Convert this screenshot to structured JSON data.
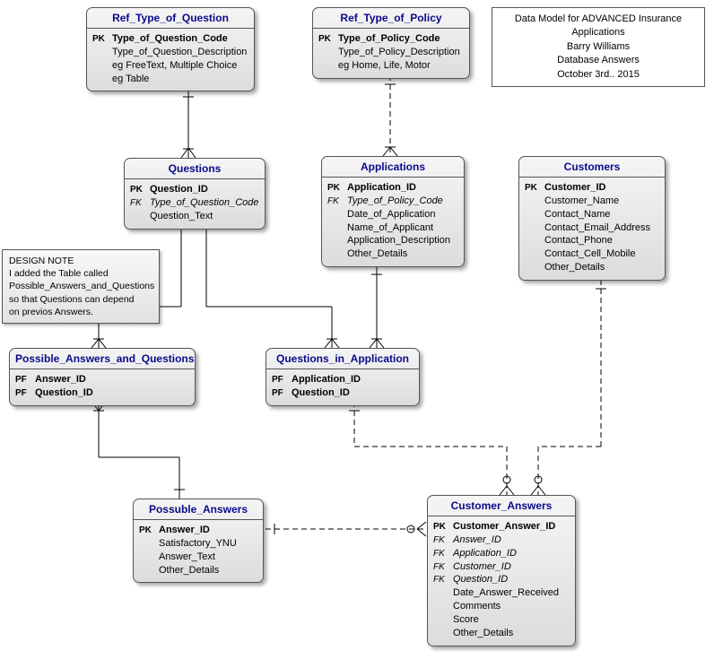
{
  "header": {
    "line1": "Data Model for ADVANCED Insurance Applications",
    "line2": "Barry Williams",
    "line3": "Database Answers",
    "line4": "October 3rd.. 2015"
  },
  "designNote": {
    "line1": "DESIGN NOTE",
    "line2": "I added the Table called",
    "line3": "Possible_Answers_and_Questions",
    "line4": "so that Questions can depend",
    "line5": "on previos Answers."
  },
  "entities": {
    "refTypeQuestion": {
      "title": "Ref_Type_of_Question",
      "attrs": [
        {
          "key": "PK",
          "name": "Type_of_Question_Code",
          "cls": "pk"
        },
        {
          "key": "",
          "name": "Type_of_Question_Description",
          "cls": ""
        },
        {
          "key": "",
          "name": "eg FreeText, Multiple Choice",
          "cls": ""
        },
        {
          "key": "",
          "name": "eg Table",
          "cls": ""
        }
      ]
    },
    "refTypePolicy": {
      "title": "Ref_Type_of_Policy",
      "attrs": [
        {
          "key": "PK",
          "name": "Type_of_Policy_Code",
          "cls": "pk"
        },
        {
          "key": "",
          "name": "Type_of_Policy_Description",
          "cls": ""
        },
        {
          "key": "",
          "name": "eg Home, Life, Motor",
          "cls": ""
        }
      ]
    },
    "questions": {
      "title": "Questions",
      "attrs": [
        {
          "key": "PK",
          "name": "Question_ID",
          "cls": "pk"
        },
        {
          "key": "FK",
          "name": "Type_of_Question_Code",
          "cls": "fk"
        },
        {
          "key": "",
          "name": "Question_Text",
          "cls": ""
        }
      ]
    },
    "applications": {
      "title": "Applications",
      "attrs": [
        {
          "key": "PK",
          "name": "Application_ID",
          "cls": "pk"
        },
        {
          "key": "FK",
          "name": "Type_of_Policy_Code",
          "cls": "fk"
        },
        {
          "key": "",
          "name": "Date_of_Application",
          "cls": ""
        },
        {
          "key": "",
          "name": "Name_of_Applicant",
          "cls": ""
        },
        {
          "key": "",
          "name": "Application_Description",
          "cls": ""
        },
        {
          "key": "",
          "name": "Other_Details",
          "cls": ""
        }
      ]
    },
    "customers": {
      "title": "Customers",
      "attrs": [
        {
          "key": "PK",
          "name": "Customer_ID",
          "cls": "pk"
        },
        {
          "key": "",
          "name": "Customer_Name",
          "cls": ""
        },
        {
          "key": "",
          "name": "Contact_Name",
          "cls": ""
        },
        {
          "key": "",
          "name": "Contact_Email_Address",
          "cls": ""
        },
        {
          "key": "",
          "name": "Contact_Phone",
          "cls": ""
        },
        {
          "key": "",
          "name": "Contact_Cell_Mobile",
          "cls": ""
        },
        {
          "key": "",
          "name": "Other_Details",
          "cls": ""
        }
      ]
    },
    "paq": {
      "title": "Possible_Answers_and_Questions",
      "attrs": [
        {
          "key": "PF",
          "name": "Answer_ID",
          "cls": "pk"
        },
        {
          "key": "PF",
          "name": "Question_ID",
          "cls": "pk"
        }
      ]
    },
    "qia": {
      "title": "Questions_in_Application",
      "attrs": [
        {
          "key": "PF",
          "name": "Application_ID",
          "cls": "pk"
        },
        {
          "key": "PF",
          "name": "Question_ID",
          "cls": "pk"
        }
      ]
    },
    "possibleAnswers": {
      "title": "Possuble_Answers",
      "attrs": [
        {
          "key": "PK",
          "name": "Answer_ID",
          "cls": "pk"
        },
        {
          "key": "",
          "name": "Satisfactory_YNU",
          "cls": ""
        },
        {
          "key": "",
          "name": "Answer_Text",
          "cls": ""
        },
        {
          "key": "",
          "name": "Other_Details",
          "cls": ""
        }
      ]
    },
    "customerAnswers": {
      "title": "Customer_Answers",
      "attrs": [
        {
          "key": "PK",
          "name": "Customer_Answer_ID",
          "cls": "pk"
        },
        {
          "key": "FK",
          "name": "Answer_ID",
          "cls": "fk"
        },
        {
          "key": "FK",
          "name": "Application_ID",
          "cls": "fk"
        },
        {
          "key": "FK",
          "name": "Customer_ID",
          "cls": "fk"
        },
        {
          "key": "FK",
          "name": "Question_ID",
          "cls": "fk"
        },
        {
          "key": "",
          "name": "Date_Answer_Received",
          "cls": ""
        },
        {
          "key": "",
          "name": "Comments",
          "cls": ""
        },
        {
          "key": "",
          "name": "Score",
          "cls": ""
        },
        {
          "key": "",
          "name": "Other_Details",
          "cls": ""
        }
      ]
    }
  }
}
